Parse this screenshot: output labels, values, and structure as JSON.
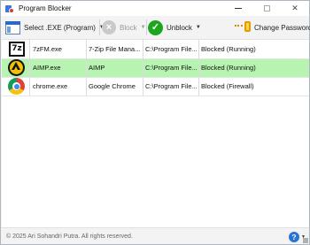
{
  "window": {
    "title": "Program Blocker"
  },
  "toolbar": {
    "select_label": "Select .EXE (Program)",
    "block_label": "Block",
    "unblock_label": "Unblock",
    "change_password_label": "Change Password"
  },
  "programs": [
    {
      "icon": "7zip-icon",
      "name": "7zFM.exe",
      "description": "7-Zip File Mana...",
      "path": "C:\\Program File...",
      "status": "Blocked (Running)",
      "selected": false
    },
    {
      "icon": "aimp-icon",
      "name": "AIMP.exe",
      "description": "AIMP",
      "path": "C:\\Program File...",
      "status": "Blocked (Running)",
      "selected": true
    },
    {
      "icon": "chrome-icon",
      "name": "chrome.exe",
      "description": "Google Chrome",
      "path": "C:\\Program File...",
      "status": "Blocked (Firewall)",
      "selected": false
    }
  ],
  "status_bar": {
    "copyright": "© 2025 Ari Sohandri Putra. All rights reserved."
  },
  "colors": {
    "selected_row": "#b7f3b1",
    "unblock_green": "#1ea51e",
    "help_blue": "#2a72d4"
  }
}
